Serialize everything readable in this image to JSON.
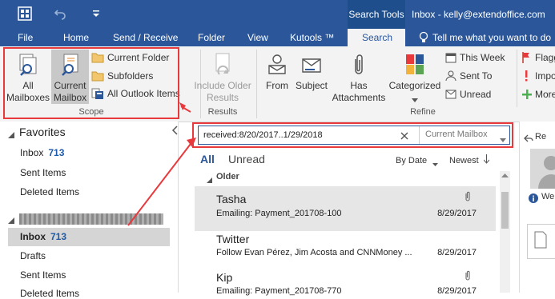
{
  "titlebar": {
    "context_tab": "Search Tools",
    "window_title": "Inbox - kelly@extendoffice.com"
  },
  "tabs": [
    "File",
    "Home",
    "Send / Receive",
    "Folder",
    "View",
    "Kutools ™",
    "Search"
  ],
  "tell_me": "Tell me what you want to do",
  "ribbon": {
    "scope": {
      "all_mailboxes": "All Mailboxes",
      "current_mailbox": "Current Mailbox",
      "current_folder": "Current Folder",
      "subfolders": "Subfolders",
      "all_outlook_items": "All Outlook Items",
      "group_label": "Scope"
    },
    "results": {
      "include_older": "Include Older Results",
      "group_label": "Results"
    },
    "refine": {
      "from": "From",
      "subject": "Subject",
      "has_attachments": "Has Attachments",
      "categorized": "Categorized",
      "this_week": "This Week",
      "sent_to": "Sent To",
      "unread": "Unread",
      "flagged": "Flagg",
      "important": "Impo",
      "more": "More",
      "group_label": "Refine"
    }
  },
  "search": {
    "query": "received:8/20/2017..1/29/2018",
    "scope_value": "Current Mailbox"
  },
  "left_pane": {
    "favorites_label": "Favorites",
    "favorites": [
      {
        "label": "Inbox",
        "count": "713"
      },
      {
        "label": "Sent Items",
        "count": ""
      },
      {
        "label": "Deleted Items",
        "count": ""
      }
    ],
    "account": [
      {
        "label": "Inbox",
        "count": "713"
      },
      {
        "label": "Drafts",
        "count": ""
      },
      {
        "label": "Sent Items",
        "count": ""
      },
      {
        "label": "Deleted Items",
        "count": ""
      }
    ]
  },
  "mail_list": {
    "filter_all": "All",
    "filter_unread": "Unread",
    "sort_by": "By Date",
    "sort_order": "Newest",
    "group_header": "Older",
    "items": [
      {
        "sender": "Tasha",
        "subject": "Emailing: Payment_201708-100",
        "date": "8/29/2017",
        "attachment": true
      },
      {
        "sender": "Twitter",
        "subject": "Follow Evan Pérez, Jim Acosta and CNNMoney ...",
        "date": "8/29/2017",
        "attachment": false
      },
      {
        "sender": "Kip",
        "subject": "Emailing: Payment_201708-770",
        "date": "8/29/2017",
        "attachment": true
      }
    ]
  },
  "reading_pane": {
    "reply_label": "Re",
    "info_label": "We"
  },
  "colors": {
    "brand": "#2b579a",
    "annotation": "#e8393d",
    "count_blue": "#1e5aa8"
  }
}
